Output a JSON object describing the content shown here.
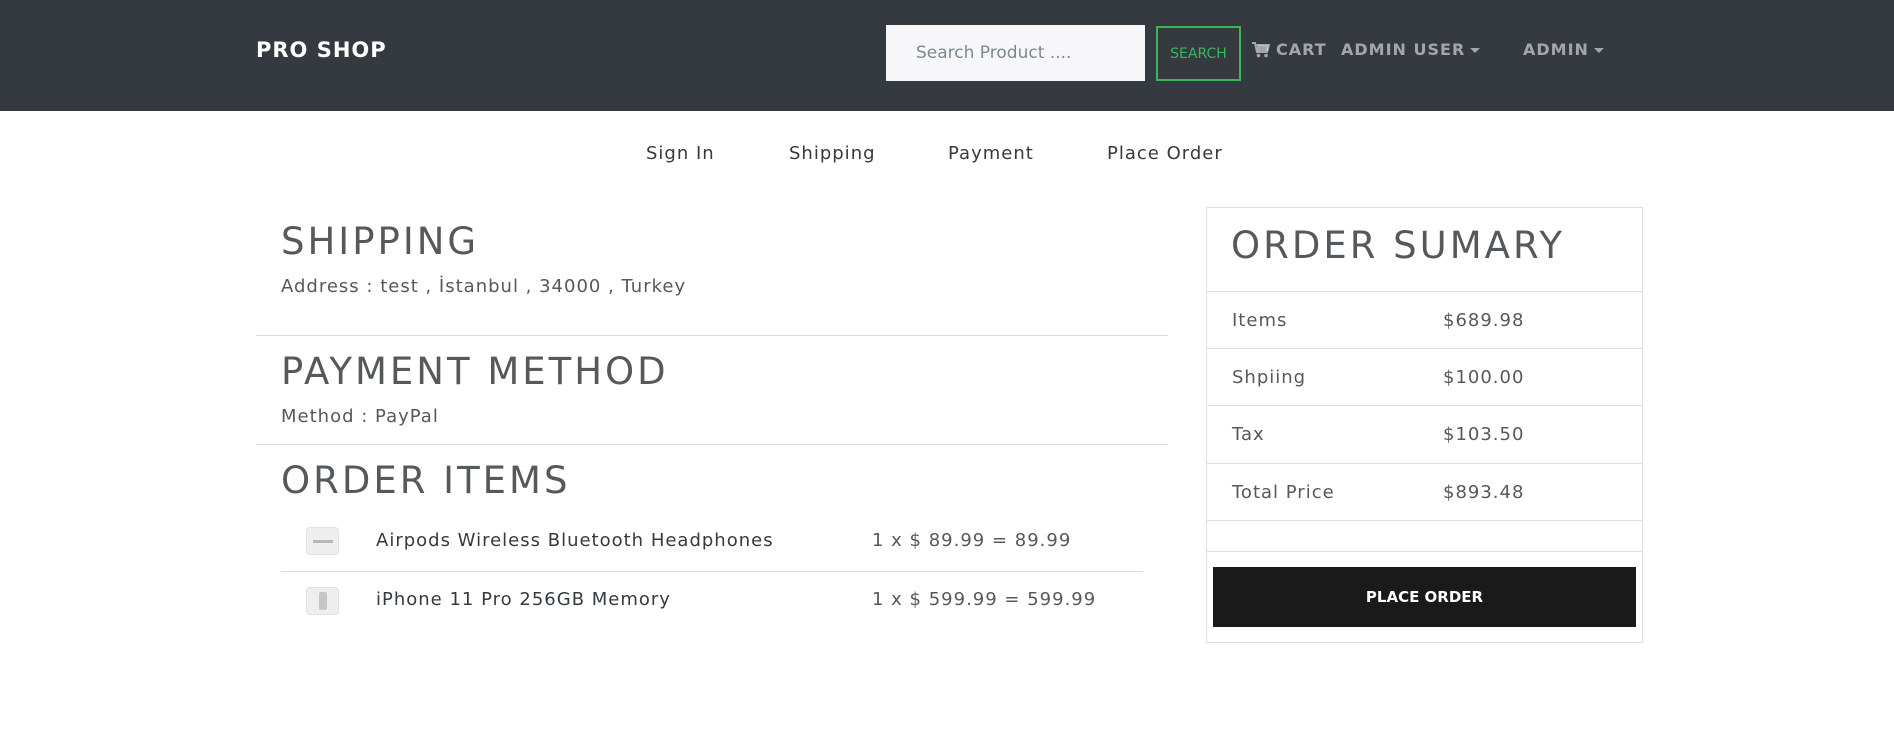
{
  "navbar": {
    "brand": "PRO SHOP",
    "search_placeholder": "Search Product ....",
    "search_button": "SEARCH",
    "cart_label": "CART",
    "user_menu": "ADMIN USER",
    "admin_menu": "ADMIN"
  },
  "steps": [
    "Sign In",
    "Shipping",
    "Payment",
    "Place Order"
  ],
  "shipping": {
    "heading": "SHIPPING",
    "address": "Address : test , İstanbul , 34000 , Turkey"
  },
  "payment": {
    "heading": "PAYMENT METHOD",
    "method": "Method : PayPal"
  },
  "order_items": {
    "heading": "ORDER ITEMS",
    "items": [
      {
        "name": "Airpods Wireless Bluetooth Headphones",
        "total": "1 x $ 89.99 = 89.99",
        "icon": "headphones-thumbnail"
      },
      {
        "name": "iPhone 11 Pro 256GB Memory",
        "total": "1 x $ 599.99 = 599.99",
        "icon": "phone-thumbnail"
      }
    ]
  },
  "summary": {
    "heading": "ORDER SUMARY",
    "rows": [
      {
        "label": "Items",
        "value": "$689.98"
      },
      {
        "label": "Shpiing",
        "value": "$100.00"
      },
      {
        "label": "Tax",
        "value": "$103.50"
      },
      {
        "label": "Total Price",
        "value": "$893.48"
      }
    ],
    "button": "PLACE ORDER"
  },
  "colors": {
    "navbar_bg": "#343a40",
    "accent_green": "#3cb45c",
    "button_dark": "#1a1a1a"
  }
}
